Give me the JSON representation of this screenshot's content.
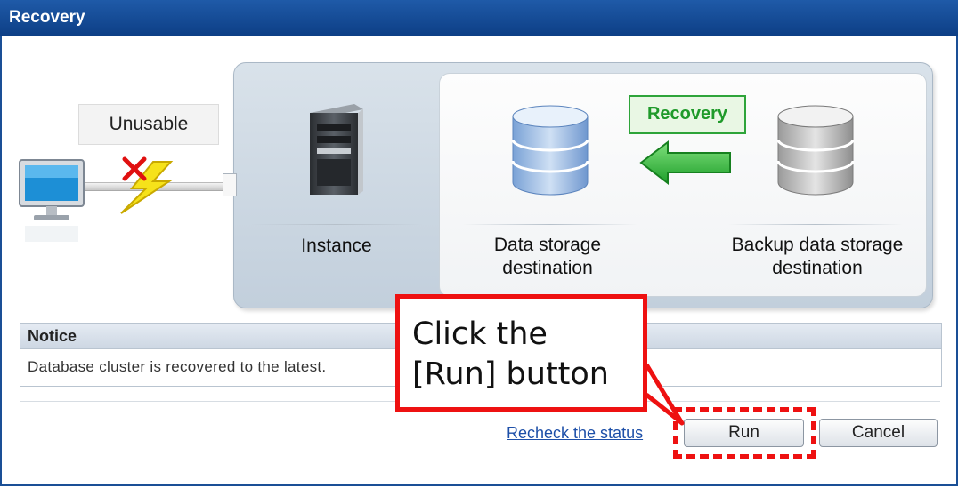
{
  "window": {
    "title": "Recovery"
  },
  "status": {
    "client_state": "Unusable"
  },
  "diagram": {
    "instance_label": "Instance",
    "data_storage_label": "Data storage destination",
    "backup_storage_label": "Backup data storage destination",
    "recovery_badge": "Recovery"
  },
  "notice": {
    "heading": "Notice",
    "message": "Database cluster is recovered to the latest."
  },
  "actions": {
    "recheck_link": "Recheck the status",
    "run_label": "Run",
    "cancel_label": "Cancel"
  },
  "annotation": {
    "callout_text": "Click the\n[Run] button"
  },
  "colors": {
    "title_bar": "#1f5aa8",
    "highlight_red": "#ee1111",
    "recovery_green": "#2ea43a",
    "link_blue": "#1d4fa8"
  },
  "icons": {
    "client": "monitor-icon",
    "error": "red-x-icon",
    "disconnect": "lightning-icon",
    "instance": "server-icon",
    "data_storage": "database-blue-icon",
    "backup_storage": "database-gray-icon",
    "direction": "arrow-left-icon"
  }
}
